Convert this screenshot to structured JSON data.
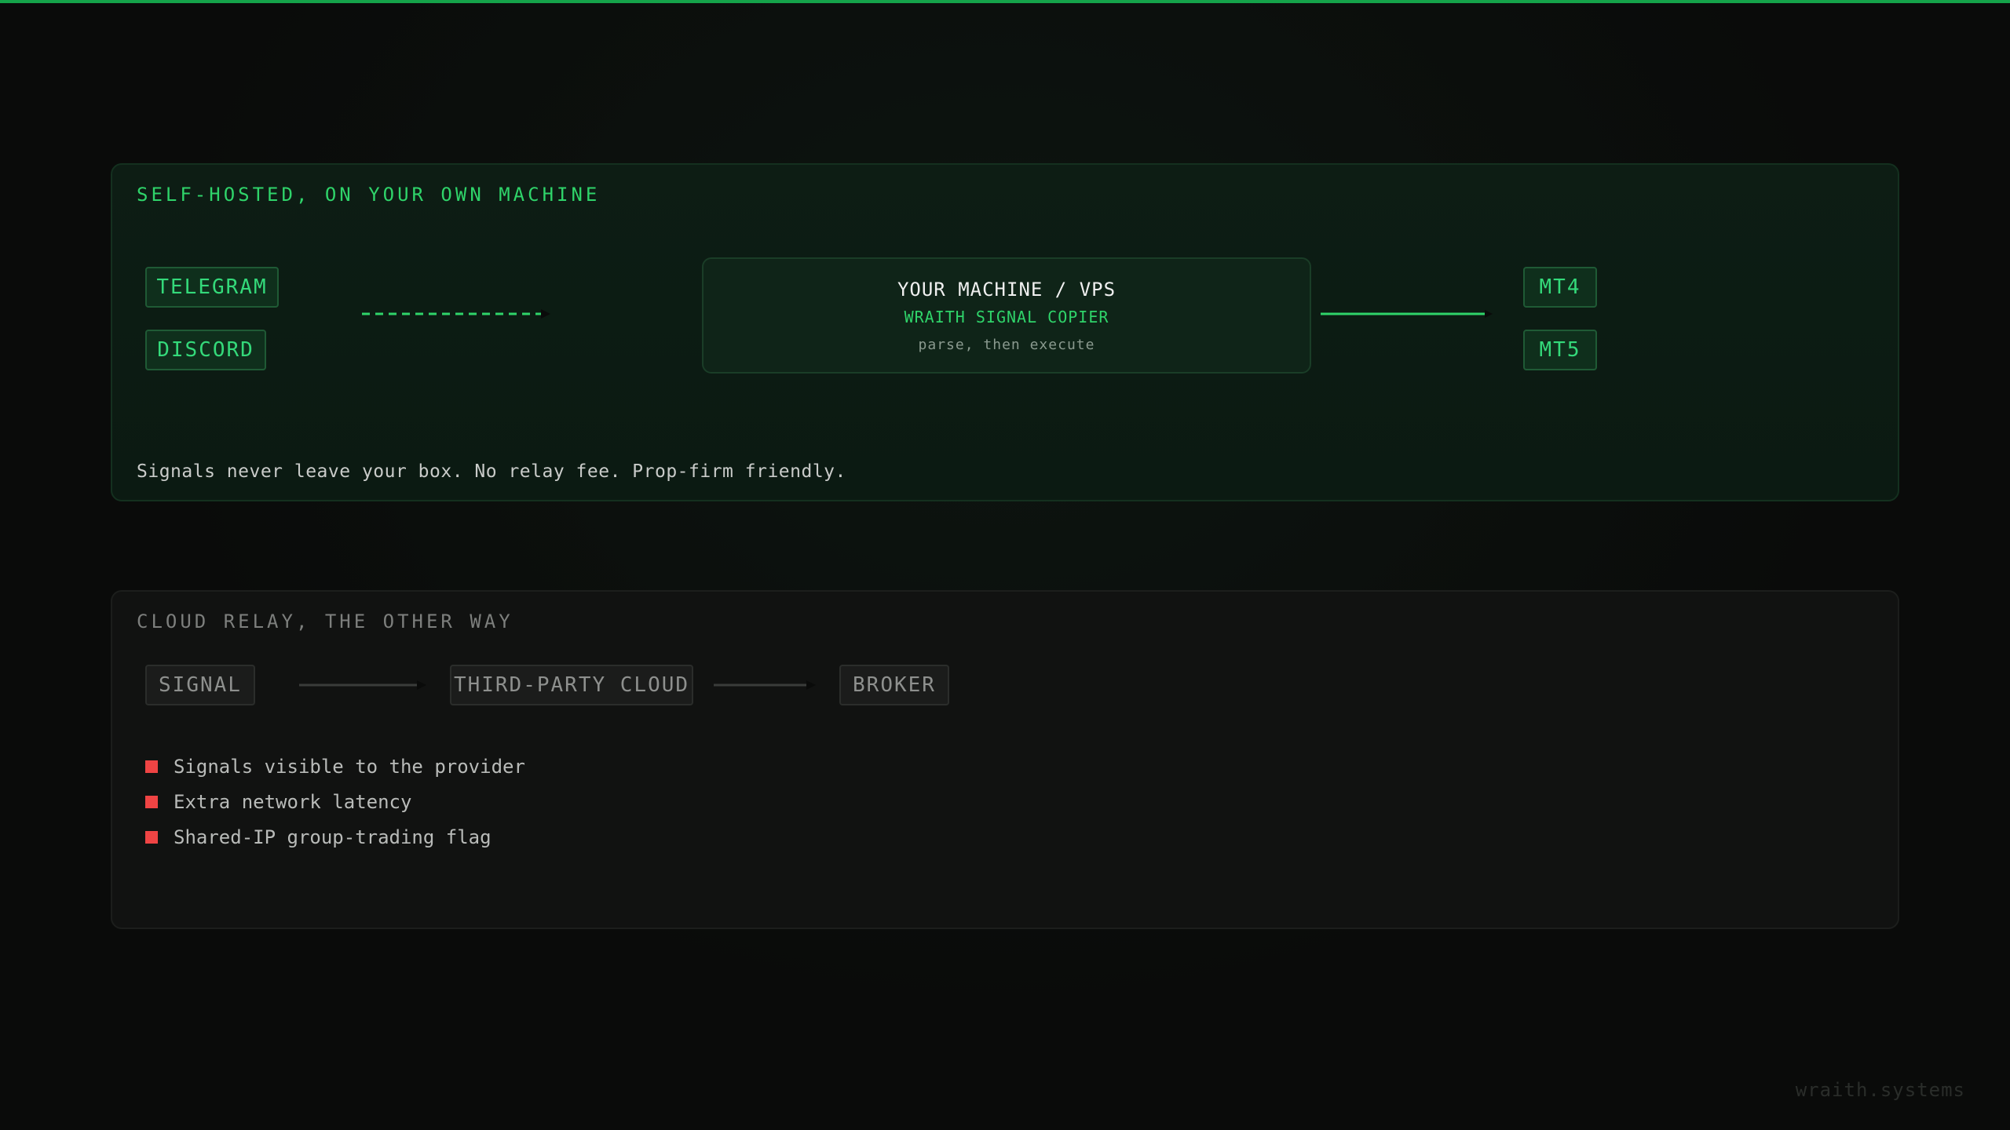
{
  "self_hosted": {
    "title": "SELF-HOSTED, ON YOUR OWN MACHINE",
    "sources": [
      "TELEGRAM",
      "DISCORD"
    ],
    "machine": {
      "title": "YOUR MACHINE / VPS",
      "subtitle": "WRAITH SIGNAL COPIER",
      "note": "parse, then execute"
    },
    "targets": [
      "MT4",
      "MT5"
    ],
    "footnote": "Signals never leave your box. No relay fee. Prop-firm friendly."
  },
  "cloud_relay": {
    "title": "CLOUD RELAY, THE OTHER WAY",
    "steps": [
      "SIGNAL",
      "THIRD-PARTY CLOUD",
      "BROKER"
    ],
    "drawbacks": [
      "Signals visible to the provider",
      "Extra network latency",
      "Shared-IP group-trading flag"
    ]
  },
  "watermark": "wraith.systems",
  "colors": {
    "accent": "#2fd46a",
    "brand_bar": "#15a34a",
    "warning": "#ef4444",
    "background": "#0a0b0a"
  }
}
